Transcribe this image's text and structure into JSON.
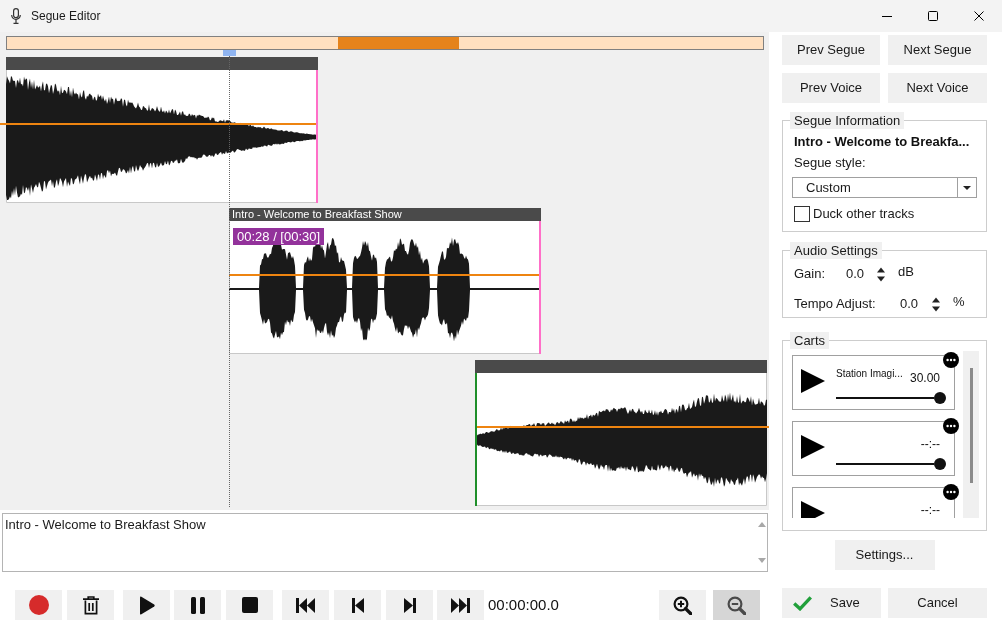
{
  "window": {
    "title": "Segue Editor"
  },
  "tracks": [
    {
      "kind": "fade_out"
    },
    {
      "kind": "speech",
      "title": "Intro - Welcome to Breakfast Show",
      "time_badge": "00:28 / [00:30]"
    },
    {
      "kind": "fade_in"
    }
  ],
  "notes": {
    "value": "Intro - Welcome to Breakfast Show"
  },
  "transport": {
    "time": "00:00:00.0",
    "zoom": [
      {
        "kind": "zoom_in",
        "selected": false
      },
      {
        "kind": "zoom_out",
        "selected": true
      }
    ]
  },
  "navigation": [
    "Prev Segue",
    "Next Segue",
    "Prev Voice",
    "Next Voice"
  ],
  "segue_information": {
    "legend": "Segue Information",
    "title": "Intro - Welcome to Breakfa...",
    "style_label": "Segue style:",
    "style": "Custom",
    "duck": {
      "label": "Duck other tracks",
      "checked": false
    }
  },
  "audio_settings": {
    "legend": "Audio Settings",
    "fields": [
      {
        "label": "Gain:",
        "value": "0.0",
        "unit": "dB"
      },
      {
        "label": "Tempo Adjust:",
        "value": "0.0",
        "unit": "%"
      }
    ]
  },
  "carts": {
    "legend": "Carts",
    "items": [
      {
        "name": "Station Imagi...",
        "duration": "30.00",
        "level": 1
      },
      {
        "duration": "--:--",
        "level": 1
      },
      {
        "duration": "--:--"
      }
    ]
  },
  "settings_button": "Settings...",
  "actions": [
    {
      "kind": "save",
      "label": "Save"
    },
    {
      "kind": "cancel",
      "label": "Cancel"
    }
  ]
}
